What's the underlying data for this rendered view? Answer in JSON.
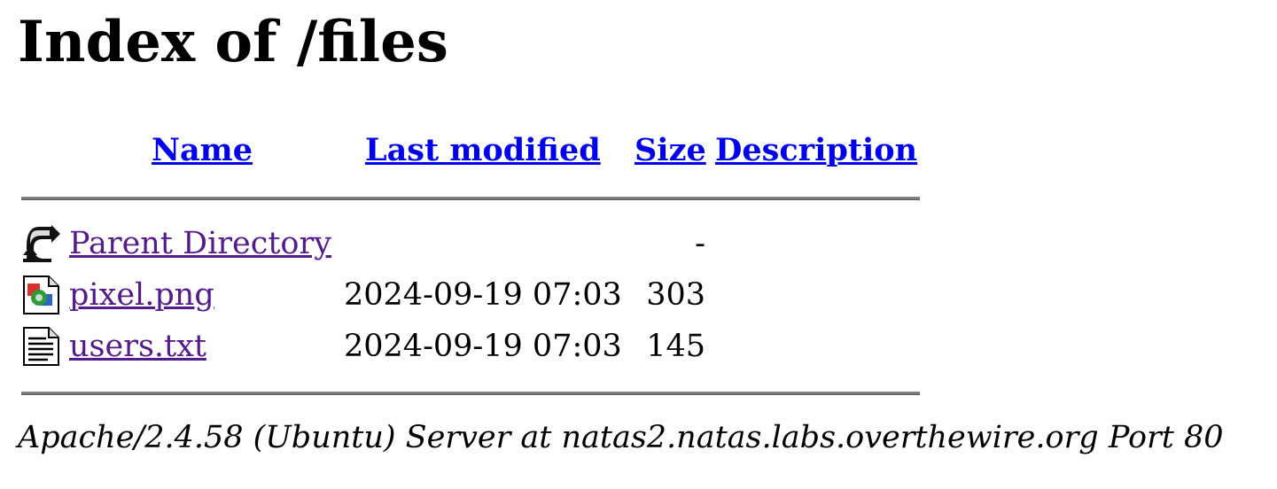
{
  "page": {
    "title": "Index of /files"
  },
  "table": {
    "headers": {
      "name": "Name",
      "last_modified": "Last modified",
      "size": "Size",
      "description": "Description"
    },
    "rows": [
      {
        "icon": "parent-directory-icon",
        "name": "Parent Directory",
        "last_modified": "",
        "size": "-",
        "description": ""
      },
      {
        "icon": "image-file-icon",
        "name": "pixel.png",
        "last_modified": "2024-09-19 07:03",
        "size": "303",
        "description": ""
      },
      {
        "icon": "text-file-icon",
        "name": "users.txt",
        "last_modified": "2024-09-19 07:03",
        "size": "145",
        "description": ""
      }
    ]
  },
  "footer": {
    "address": "Apache/2.4.58 (Ubuntu) Server at natas2.natas.labs.overthewire.org Port 80"
  },
  "colors": {
    "link": "#0000ee",
    "visited_link": "#551a8b",
    "rule": "#7a7a7a"
  }
}
